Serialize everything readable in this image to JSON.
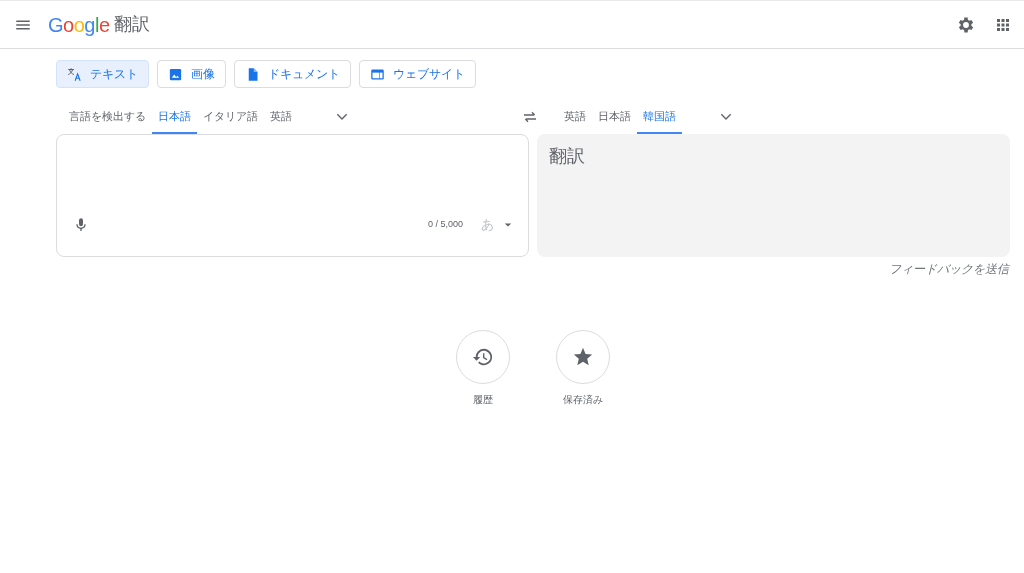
{
  "header": {
    "logo": "Google",
    "product": "翻訳"
  },
  "modes": [
    {
      "label": "テキスト",
      "kind": "text",
      "selected": true
    },
    {
      "label": "画像",
      "kind": "image",
      "selected": false
    },
    {
      "label": "ドキュメント",
      "kind": "document",
      "selected": false
    },
    {
      "label": "ウェブサイト",
      "kind": "website",
      "selected": false
    }
  ],
  "source_languages": [
    {
      "label": "言語を検出する",
      "selected": false
    },
    {
      "label": "日本語",
      "selected": true
    },
    {
      "label": "イタリア語",
      "selected": false
    },
    {
      "label": "英語",
      "selected": false
    }
  ],
  "target_languages": [
    {
      "label": "英語",
      "selected": false
    },
    {
      "label": "日本語",
      "selected": false
    },
    {
      "label": "韓国語",
      "selected": true
    }
  ],
  "source": {
    "counter": "0 / 5,000",
    "ime": "あ"
  },
  "target": {
    "hint": "翻訳"
  },
  "feedback": "フィードバックを送信",
  "shortcuts": [
    {
      "label": "履歴",
      "kind": "history"
    },
    {
      "label": "保存済み",
      "kind": "saved"
    }
  ]
}
